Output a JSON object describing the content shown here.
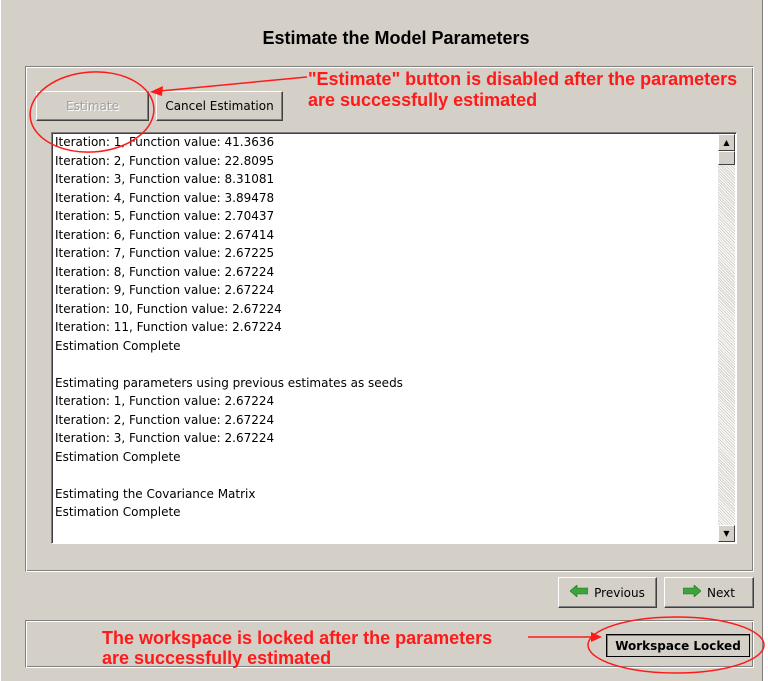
{
  "page": {
    "title": "Estimate the Model Parameters"
  },
  "toolbar": {
    "estimate_label": "Estimate",
    "cancel_label": "Cancel Estimation"
  },
  "log": {
    "lines": [
      "Iteration: 1, Function value: 41.3636",
      "Iteration: 2, Function value: 22.8095",
      "Iteration: 3, Function value: 8.31081",
      "Iteration: 4, Function value: 3.89478",
      "Iteration: 5, Function value: 2.70437",
      "Iteration: 6, Function value: 2.67414",
      "Iteration: 7, Function value: 2.67225",
      "Iteration: 8, Function value: 2.67224",
      "Iteration: 9, Function value: 2.67224",
      "Iteration: 10, Function value: 2.67224",
      "Iteration: 11, Function value: 2.67224",
      "Estimation Complete",
      "",
      "Estimating parameters using previous estimates as seeds",
      "Iteration: 1, Function value: 2.67224",
      "Iteration: 2, Function value: 2.67224",
      "Iteration: 3, Function value: 2.67224",
      "Estimation Complete",
      "",
      "Estimating the Covariance Matrix",
      "Estimation Complete"
    ]
  },
  "nav": {
    "previous_label": "Previous",
    "next_label": "Next"
  },
  "status": {
    "workspace_label": "Workspace Locked"
  },
  "annotations": {
    "estimate_note_line1": "\"Estimate\" button is disabled after the parameters",
    "estimate_note_line2": "are successfully estimated",
    "locked_note_line1": "The workspace is locked after the parameters",
    "locked_note_line2": "are successfully estimated"
  },
  "colors": {
    "annotation": "#ff1a1a",
    "arrow_green": "#3aa63a",
    "window_bg": "#d4d0c8"
  },
  "icons": {
    "previous": "arrow-left-icon",
    "next": "arrow-right-icon",
    "scroll_up": "scroll-up-icon",
    "scroll_down": "scroll-down-icon"
  }
}
